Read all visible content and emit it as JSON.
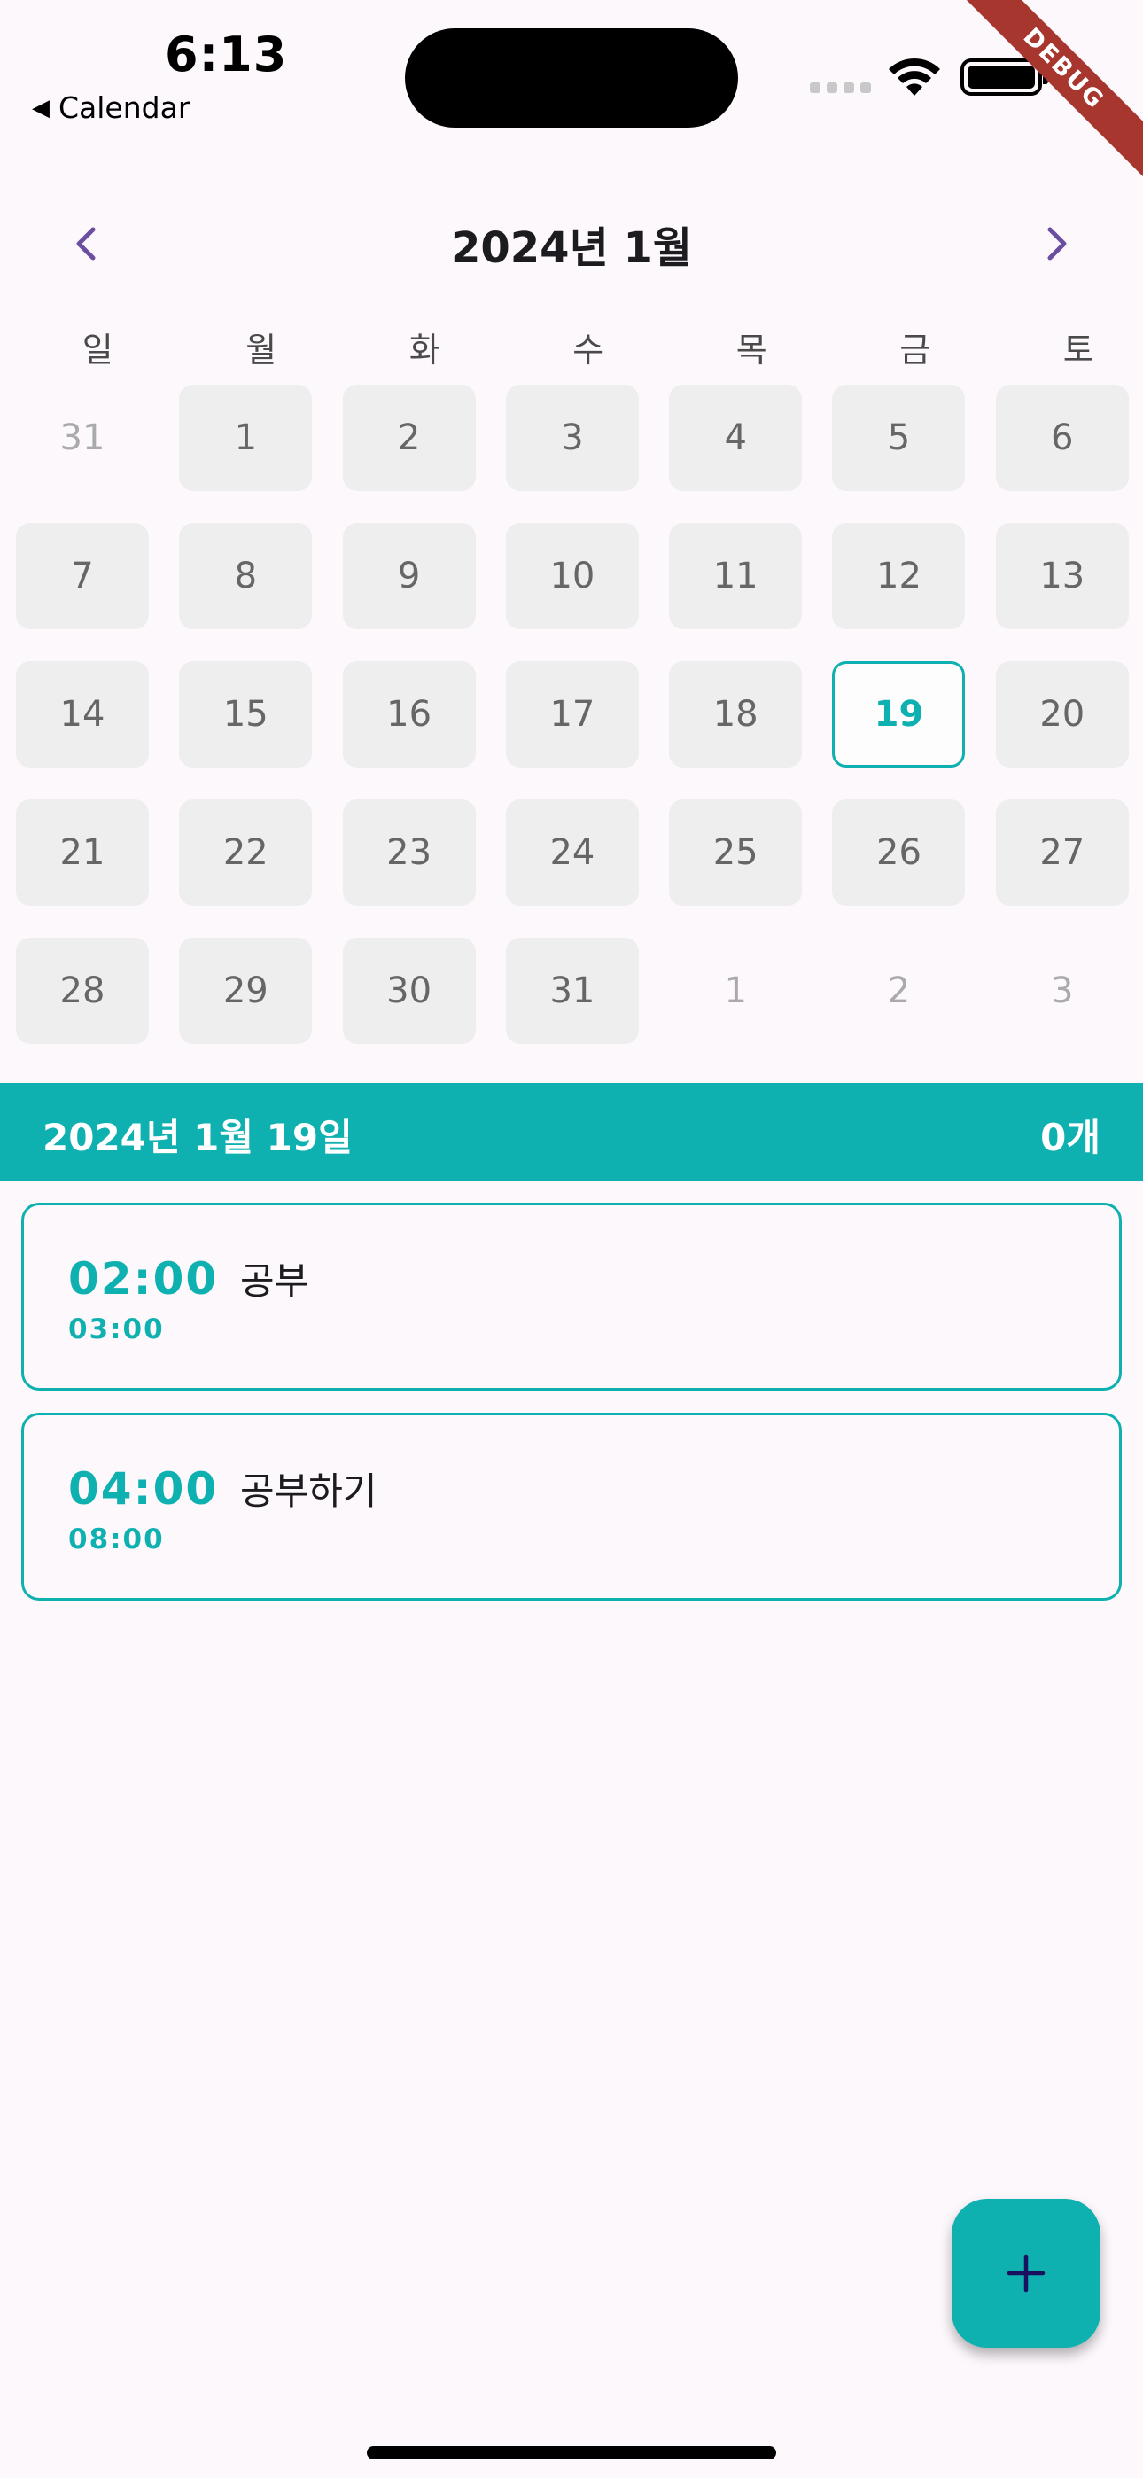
{
  "status_bar": {
    "time": "6:13",
    "back_app": "Calendar"
  },
  "debug_label": "DEBUG",
  "calendar": {
    "title": "2024년 1월",
    "weekdays": [
      "일",
      "월",
      "화",
      "수",
      "목",
      "금",
      "토"
    ],
    "days": [
      {
        "label": "31",
        "kind": "other"
      },
      {
        "label": "1",
        "kind": "current"
      },
      {
        "label": "2",
        "kind": "current"
      },
      {
        "label": "3",
        "kind": "current"
      },
      {
        "label": "4",
        "kind": "current"
      },
      {
        "label": "5",
        "kind": "current"
      },
      {
        "label": "6",
        "kind": "current"
      },
      {
        "label": "7",
        "kind": "current"
      },
      {
        "label": "8",
        "kind": "current"
      },
      {
        "label": "9",
        "kind": "current"
      },
      {
        "label": "10",
        "kind": "current"
      },
      {
        "label": "11",
        "kind": "current"
      },
      {
        "label": "12",
        "kind": "current"
      },
      {
        "label": "13",
        "kind": "current"
      },
      {
        "label": "14",
        "kind": "current"
      },
      {
        "label": "15",
        "kind": "current"
      },
      {
        "label": "16",
        "kind": "current"
      },
      {
        "label": "17",
        "kind": "current"
      },
      {
        "label": "18",
        "kind": "current"
      },
      {
        "label": "19",
        "kind": "selected"
      },
      {
        "label": "20",
        "kind": "current"
      },
      {
        "label": "21",
        "kind": "current"
      },
      {
        "label": "22",
        "kind": "current"
      },
      {
        "label": "23",
        "kind": "current"
      },
      {
        "label": "24",
        "kind": "current"
      },
      {
        "label": "25",
        "kind": "current"
      },
      {
        "label": "26",
        "kind": "current"
      },
      {
        "label": "27",
        "kind": "current"
      },
      {
        "label": "28",
        "kind": "current"
      },
      {
        "label": "29",
        "kind": "current"
      },
      {
        "label": "30",
        "kind": "current"
      },
      {
        "label": "31",
        "kind": "current"
      },
      {
        "label": "1",
        "kind": "other"
      },
      {
        "label": "2",
        "kind": "other"
      },
      {
        "label": "3",
        "kind": "other"
      }
    ]
  },
  "banner": {
    "date": "2024년 1월 19일",
    "count": "0개"
  },
  "schedules": [
    {
      "start": "02:00",
      "end": "03:00",
      "title": "공부"
    },
    {
      "start": "04:00",
      "end": "08:00",
      "title": "공부하기"
    }
  ],
  "colors": {
    "accent": "#0fb1b0",
    "nav_arrow": "#6a4fa0",
    "fab_icon": "#1a1060",
    "background": "#fdf8fc"
  },
  "icons": {
    "prev": "chevron-left-icon",
    "next": "chevron-right-icon",
    "fab": "plus-icon"
  }
}
